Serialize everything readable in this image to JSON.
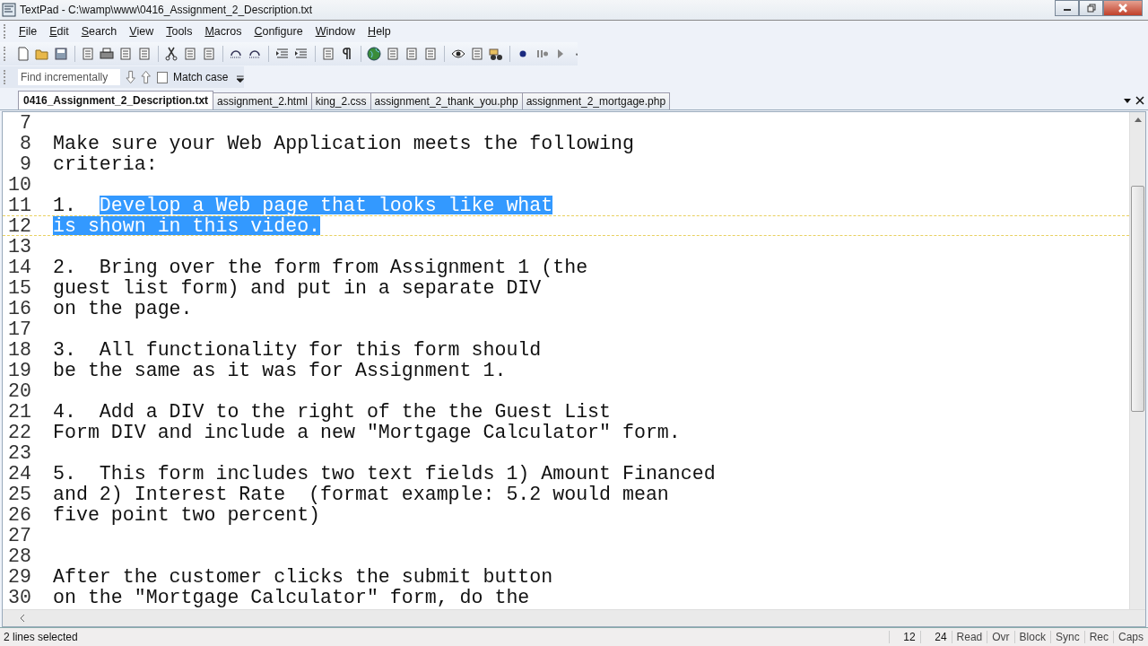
{
  "window": {
    "title": "TextPad - C:\\wamp\\www\\0416_Assignment_2_Description.txt"
  },
  "menu": [
    "File",
    "Edit",
    "Search",
    "View",
    "Tools",
    "Macros",
    "Configure",
    "Window",
    "Help"
  ],
  "find_bar": {
    "placeholder": "Find incrementally",
    "match_case": {
      "label": "Match case",
      "checked": false
    }
  },
  "tabs": [
    {
      "label": "0416_Assignment_2_Description.txt",
      "selected": true
    },
    {
      "label": "assignment_2.html",
      "selected": false
    },
    {
      "label": "king_2.css",
      "selected": false
    },
    {
      "label": "assignment_2_thank_you.php",
      "selected": false
    },
    {
      "label": "assignment_2_mortgage.php",
      "selected": false
    }
  ],
  "editor": {
    "lines": [
      {
        "number": "7",
        "current": false
      },
      {
        "number": "8",
        "current": false,
        "segments": [
          {
            "text": "Make sure your Web Application meets the following",
            "selected": false
          }
        ]
      },
      {
        "number": "9",
        "current": false,
        "segments": [
          {
            "text": "criteria:",
            "selected": false
          }
        ]
      },
      {
        "number": "10",
        "current": false
      },
      {
        "number": "11",
        "current": false,
        "segments": [
          {
            "text": "1.  ",
            "selected": false
          },
          {
            "text": "Develop a Web page that looks like what",
            "selected": true
          }
        ]
      },
      {
        "number": "12",
        "current": true,
        "segments": [
          {
            "text": "is shown in this video.",
            "selected": true
          }
        ]
      },
      {
        "number": "13",
        "current": false
      },
      {
        "number": "14",
        "current": false,
        "segments": [
          {
            "text": "2.  Bring over the form from Assignment 1 (the",
            "selected": false
          }
        ]
      },
      {
        "number": "15",
        "current": false,
        "segments": [
          {
            "text": "guest list form) and put in a separate DIV",
            "selected": false
          }
        ]
      },
      {
        "number": "16",
        "current": false,
        "segments": [
          {
            "text": "on the page.",
            "selected": false
          }
        ]
      },
      {
        "number": "17",
        "current": false
      },
      {
        "number": "18",
        "current": false,
        "segments": [
          {
            "text": "3.  All functionality for this form should",
            "selected": false
          }
        ]
      },
      {
        "number": "19",
        "current": false,
        "segments": [
          {
            "text": "be the same as it was for Assignment 1.",
            "selected": false
          }
        ]
      },
      {
        "number": "20",
        "current": false
      },
      {
        "number": "21",
        "current": false,
        "segments": [
          {
            "text": "4.  Add a DIV to the right of the the Guest List",
            "selected": false
          }
        ]
      },
      {
        "number": "22",
        "current": false,
        "segments": [
          {
            "text": "Form DIV and include a new \"Mortgage Calculator\" form.",
            "selected": false
          }
        ]
      },
      {
        "number": "23",
        "current": false
      },
      {
        "number": "24",
        "current": false,
        "segments": [
          {
            "text": "5.  This form includes two text fields 1) Amount Financed",
            "selected": false
          }
        ]
      },
      {
        "number": "25",
        "current": false,
        "segments": [
          {
            "text": "and 2) Interest Rate  (format example: 5.2 would mean",
            "selected": false
          }
        ]
      },
      {
        "number": "26",
        "current": false,
        "segments": [
          {
            "text": "five point two percent)",
            "selected": false
          }
        ]
      },
      {
        "number": "27",
        "current": false
      },
      {
        "number": "28",
        "current": false
      },
      {
        "number": "29",
        "current": false,
        "segments": [
          {
            "text": "After the customer clicks the submit button",
            "selected": false
          }
        ]
      },
      {
        "number": "30",
        "current": false,
        "segments": [
          {
            "text": "on the \"Mortgage Calculator\" form, do the",
            "selected": false
          }
        ]
      }
    ]
  },
  "status_bar": {
    "message": "2 lines selected",
    "line": "12",
    "column": "24",
    "indicators": [
      "Read",
      "Ovr",
      "Block",
      "Sync",
      "Rec",
      "Caps"
    ]
  }
}
